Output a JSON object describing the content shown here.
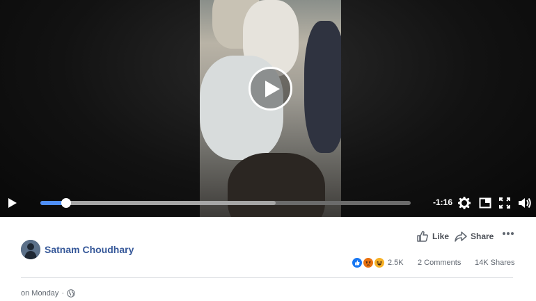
{
  "video": {
    "time_remaining": "-1:16",
    "progress": 0.07,
    "buffered": 0.635,
    "icons": {
      "big_play": "play-circle-icon",
      "play": "play-icon",
      "settings": "gear-icon",
      "pip": "picture-in-picture-icon",
      "fullscreen": "fullscreen-icon",
      "volume": "volume-icon"
    }
  },
  "post": {
    "author": "Satnam Choudhary",
    "like_label": "Like",
    "share_label": "Share",
    "reaction_count": "2.5K",
    "comments": "2 Comments",
    "shares": "14K Shares",
    "timestamp": "on Monday",
    "timestamp_separator": "·",
    "reactions": [
      "like",
      "angry",
      "haha"
    ],
    "colors": {
      "link": "#365899",
      "like": "#1877f2",
      "angry": "#e9710f",
      "haha": "#f7b125"
    }
  }
}
